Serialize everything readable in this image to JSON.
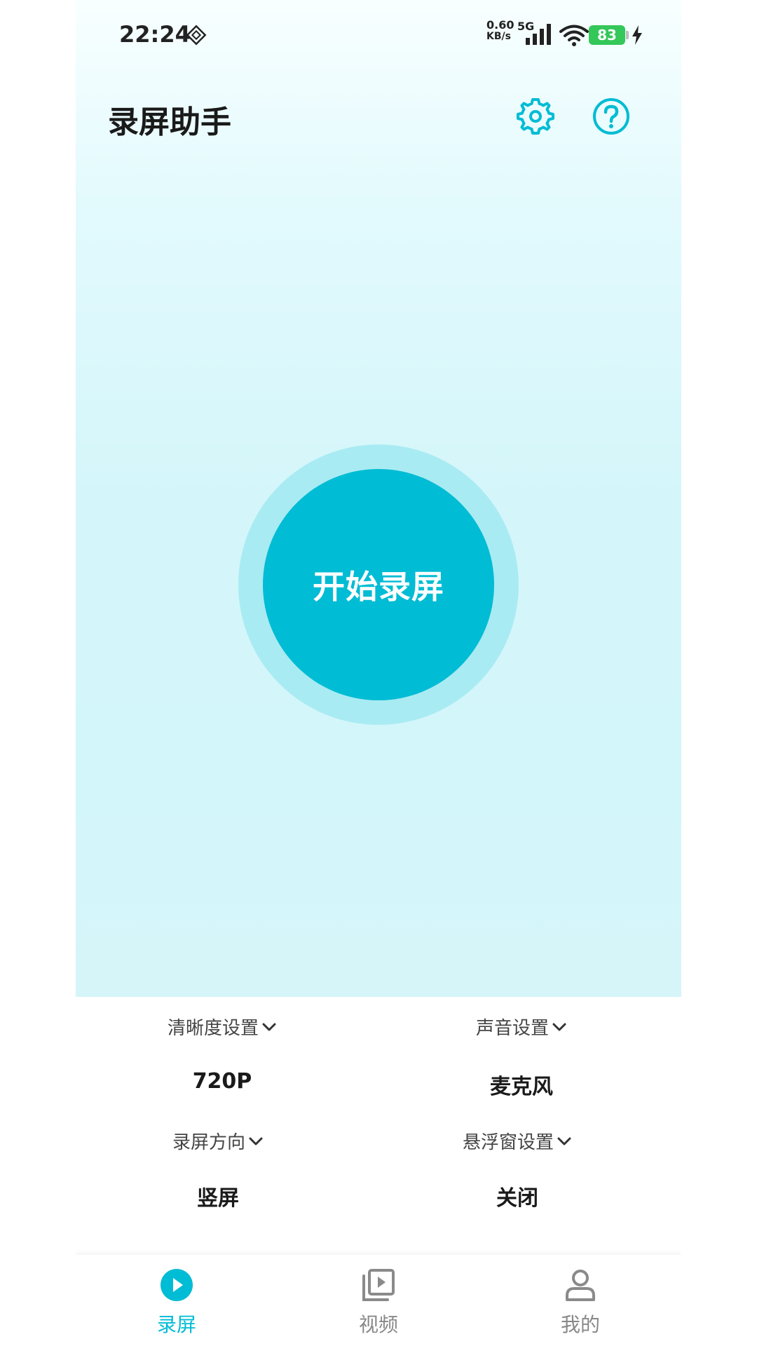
{
  "status_bar": {
    "time": "22:24",
    "net_speed_value": "0.60",
    "net_speed_unit": "KB/s",
    "network_type": "5G",
    "battery": "83",
    "icons": [
      "location-diamond-icon",
      "signal-icon",
      "wifi-icon",
      "battery-icon",
      "charging-bolt-icon"
    ]
  },
  "header": {
    "title": "录屏助手",
    "icons": [
      "gear-icon",
      "help-icon"
    ]
  },
  "record_button": {
    "label": "开始录屏"
  },
  "settings": [
    {
      "label": "清晰度设置",
      "value": "720P"
    },
    {
      "label": "声音设置",
      "value": "麦克风"
    },
    {
      "label": "录屏方向",
      "value": "竖屏"
    },
    {
      "label": "悬浮窗设置",
      "value": "关闭"
    }
  ],
  "bottom_nav": {
    "items": [
      {
        "label": "录屏",
        "icon": "play-circle-icon",
        "active": true
      },
      {
        "label": "视频",
        "icon": "video-library-icon",
        "active": false
      },
      {
        "label": "我的",
        "icon": "person-icon",
        "active": false
      }
    ]
  },
  "colors": {
    "accent": "#00bcd4",
    "halo": "#a9ebf3",
    "hero_bg": "#d4f6fa",
    "inactive": "#888888"
  }
}
